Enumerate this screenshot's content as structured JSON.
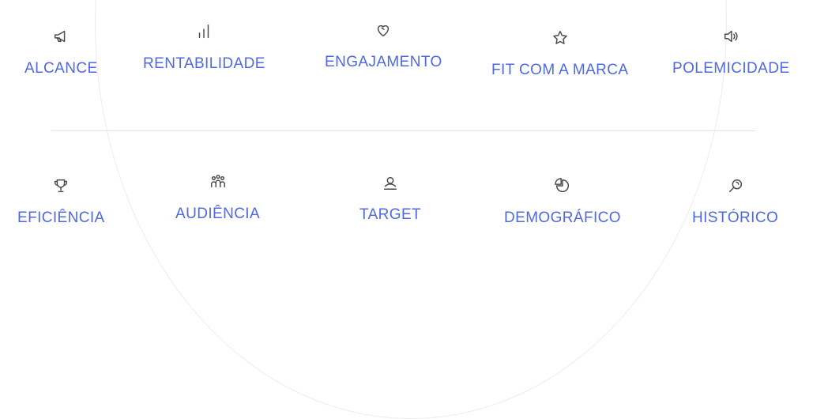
{
  "metrics_row_1": [
    {
      "label": "ALCANCE",
      "icon": "megaphone-icon"
    },
    {
      "label": "RENTABILIDADE",
      "icon": "bar-chart-icon"
    },
    {
      "label": "ENGAJAMENTO",
      "icon": "heart-icon"
    },
    {
      "label": "FIT COM A MARCA",
      "icon": "star-icon"
    },
    {
      "label": "POLEMICIDADE",
      "icon": "speaker-icon"
    }
  ],
  "metrics_row_2": [
    {
      "label": "EFICIÊNCIA",
      "icon": "trophy-icon"
    },
    {
      "label": "AUDIÊNCIA",
      "icon": "people-group-icon"
    },
    {
      "label": "TARGET",
      "icon": "user-icon"
    },
    {
      "label": "DEMOGRÁFICO",
      "icon": "pie-chart-icon"
    },
    {
      "label": "HISTÓRICO",
      "icon": "magnifier-icon"
    }
  ],
  "colors": {
    "label": "#4f68e6",
    "icon": "#4a4a4a",
    "divider": "#e6e6e6"
  }
}
